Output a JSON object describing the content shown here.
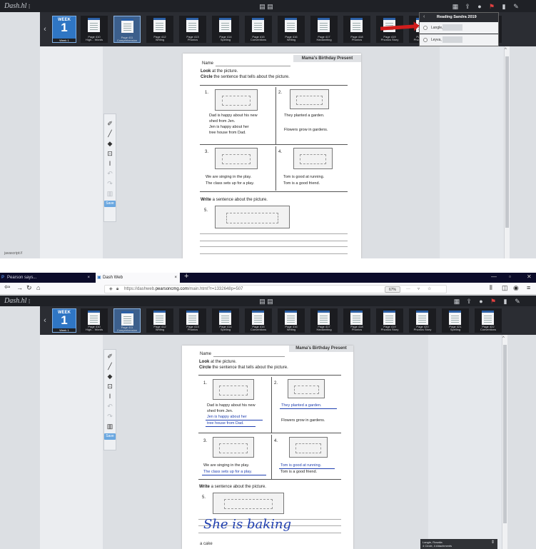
{
  "app": {
    "logo": "Dash.hl",
    "toolbar_mid": "▤ ▤",
    "right_icons": [
      "calendar-icon",
      "share-icon",
      "user-icon",
      "flag-icon",
      "bookmark-icon",
      "pen-icon"
    ]
  },
  "week": {
    "label": "WEEK",
    "number": "1",
    "caption": "Week 1"
  },
  "pages": [
    {
      "label": "Page 410\nHigh... Words"
    },
    {
      "label": "Page 411\nComprehension"
    },
    {
      "label": "Page 412\nWriting"
    },
    {
      "label": "Page 413\nPhonics"
    },
    {
      "label": "Page 414\nSpelling"
    },
    {
      "label": "Page 415\nConventions"
    },
    {
      "label": "Page 416\nWriting"
    },
    {
      "label": "Page 417\nHandwriting"
    },
    {
      "label": "Page 418\nPhonics"
    },
    {
      "label": "Page 419\nPhonics Story"
    },
    {
      "label": "Page 420\nPhonics Story"
    },
    {
      "label": "Page 421\nSpelling"
    },
    {
      "label": "Page 422\nConventions"
    }
  ],
  "tools": {
    "save": "Save"
  },
  "worksheet": {
    "title": "Mama's Birthday Present",
    "name_label": "Name",
    "look_bold": "Look",
    "look_rest": " at the picture.",
    "circle_bold": "Circle",
    "circle_rest": " the sentence that tells about the picture.",
    "n1": "1.",
    "n2": "2.",
    "n3": "3.",
    "n4": "4.",
    "n5": "5.",
    "q1a1": "Dad is happy about his new",
    "q1a2": "shed from Jen.",
    "q1b1": "Jen is happy about her",
    "q1b2": "tree house from Dad.",
    "q2a": "They planted a garden.",
    "q2b": "Flowers grow in gardens.",
    "q3a": "We are singing in the play.",
    "q3b": "The class sets up for a play.",
    "q4a": "Tom is good at running.",
    "q4b": "Tom is a good friend.",
    "write_bold": "Write",
    "write_rest": " a sentence about the picture.",
    "handwriting": "She is baking",
    "handwriting2": "a cake"
  },
  "popup": {
    "title": "Reading Sandra 2019",
    "row1": "Langle, F",
    "row2": "Leyva, A"
  },
  "status_text": "javascript://",
  "browser": {
    "tab1": "Pearson says...",
    "tab2": "Dash Web",
    "tab_close": "×",
    "new_tab": "+",
    "url_prefix": "https://dashweb.",
    "url_domain": "pearsoncmg.com",
    "url_path": "/main.html?r=1332648p=507",
    "zoom": "67%",
    "more": "···",
    "win_min": "—",
    "win_max": "▫",
    "win_close": "✕"
  },
  "toast": {
    "line1": "Langle, Rosalia",
    "line2": "4 Circle, 4 Attachments"
  },
  "colors": {
    "accent": "#2f76c4",
    "ink": "#1f3fb0",
    "arrow": "#d01d1d"
  }
}
